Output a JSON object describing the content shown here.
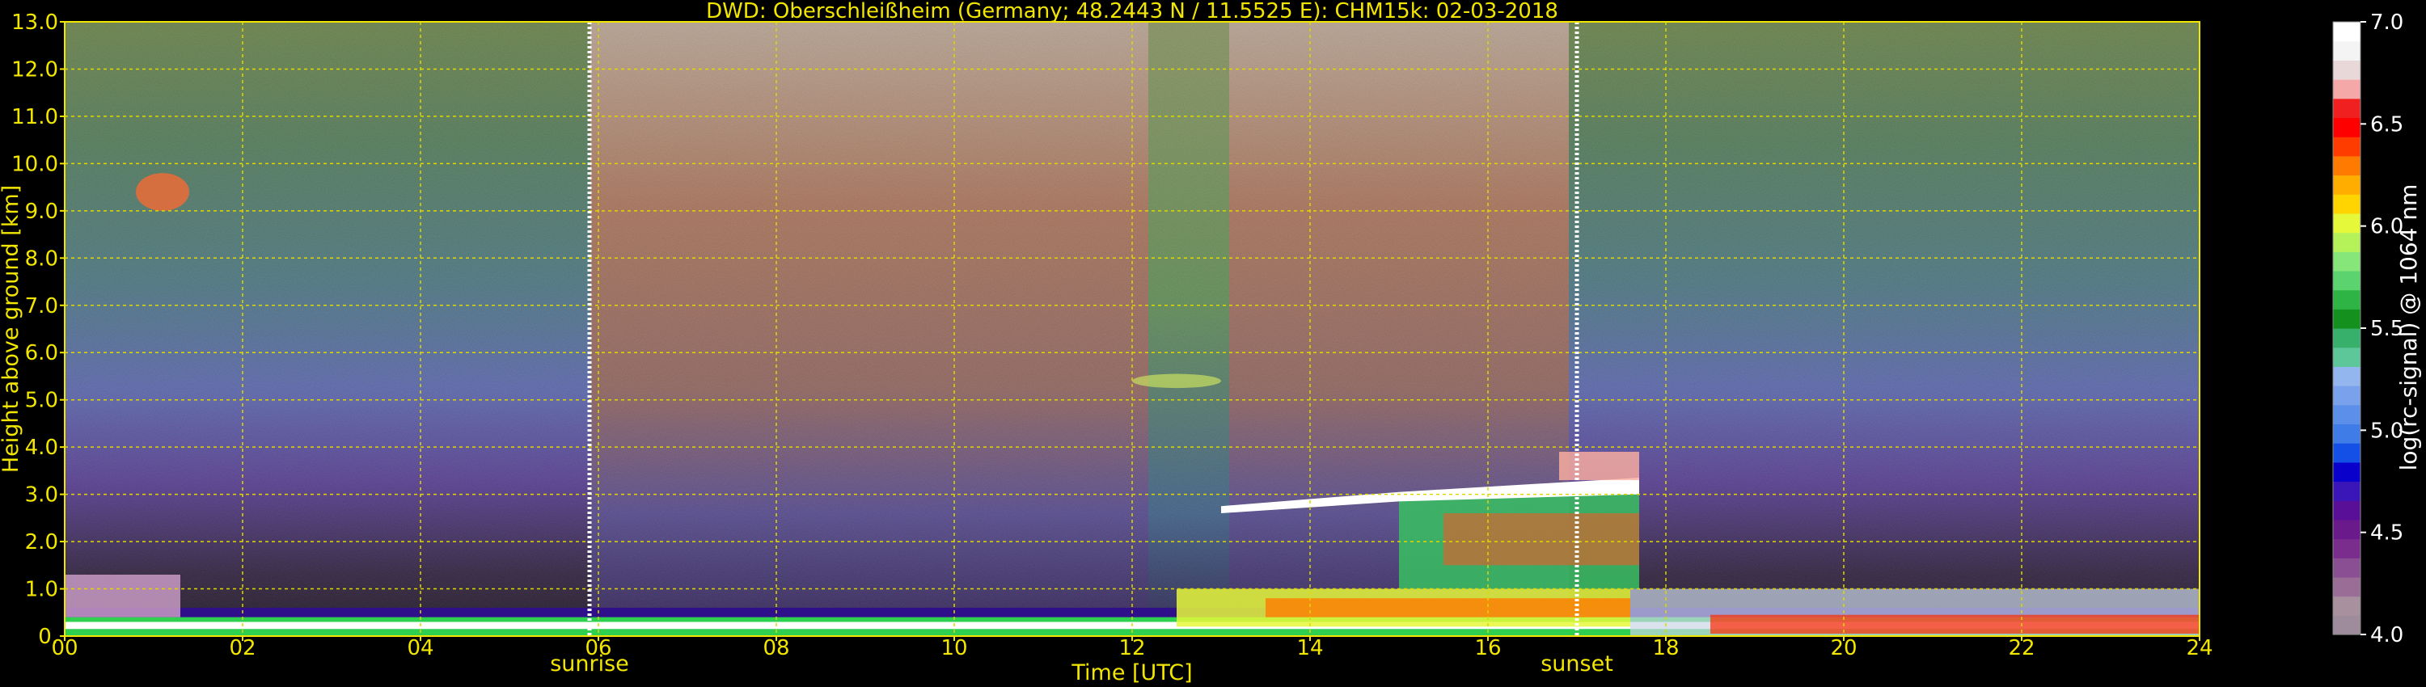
{
  "chart_data": {
    "type": "heatmap",
    "title": "DWD: Oberschleißheim (Germany; 48.2443 N / 11.5525 E):    CHM15k: 02-03-2018",
    "xlabel": "Time [UTC]",
    "ylabel": "Height above ground [km]",
    "xlim": [
      0,
      24
    ],
    "ylim": [
      0,
      13
    ],
    "x_ticks": [
      0,
      2,
      4,
      6,
      8,
      10,
      12,
      14,
      16,
      18,
      20,
      22,
      24
    ],
    "x_tick_labels": [
      "00",
      "02",
      "04",
      "06",
      "08",
      "10",
      "12",
      "14",
      "16",
      "18",
      "20",
      "22",
      "24"
    ],
    "y_ticks": [
      0,
      1,
      2,
      3,
      4,
      5,
      6,
      7,
      8,
      9,
      10,
      11,
      12,
      13
    ],
    "y_tick_labels": [
      "0.",
      "1.0",
      "2.0",
      "3.0",
      "4.0",
      "5.0",
      "6.0",
      "7.0",
      "8.0",
      "9.0",
      "10.0",
      "11.0",
      "12.0",
      "13.0"
    ],
    "grid": true,
    "annotations": [
      {
        "text": "sunrise",
        "x": 5.9
      },
      {
        "text": "sunset",
        "x": 17.0
      }
    ],
    "colorbar": {
      "label": "log(rc-signal) @ 1064 nm",
      "range": [
        4.0,
        7.0
      ],
      "ticks": [
        4.0,
        4.5,
        5.0,
        5.5,
        6.0,
        6.5,
        7.0
      ],
      "tick_labels": [
        "4.0",
        "4.5",
        "5.0",
        "5.5",
        "6.0",
        "6.5",
        "7.0"
      ],
      "colors": [
        "#9e8c9c",
        "#a8909e",
        "#9a6d97",
        "#8a4f92",
        "#7b2d8d",
        "#6a1a8a",
        "#5a0f99",
        "#3a16b8",
        "#0a00cc",
        "#1450e6",
        "#3f7ce8",
        "#5b8fea",
        "#7aa2ec",
        "#94b6ee",
        "#5ec79a",
        "#36b06a",
        "#14901f",
        "#2eb444",
        "#5bd36e",
        "#86e67a",
        "#b5f25a",
        "#e6f83a",
        "#ffd400",
        "#ffae00",
        "#ff7a00",
        "#ff3c00",
        "#ff0000",
        "#f02020",
        "#f4a8a8",
        "#e8d8d8",
        "#f4f4f4",
        "#ffffff"
      ]
    },
    "features": [
      {
        "name": "surface layer",
        "t_start": 0,
        "t_end": 24,
        "h_low": 0.0,
        "h_high": 0.4
      },
      {
        "name": "cloud layer",
        "t_start": 13.0,
        "t_end": 17.7,
        "h_low": 2.8,
        "h_high": 3.9
      },
      {
        "name": "thin layer",
        "t_start": 12.0,
        "t_end": 13.0,
        "h_low": 5.1,
        "h_high": 5.7
      },
      {
        "name": "aerosol patch",
        "t_start": 0.8,
        "t_end": 1.4,
        "h_low": 9.0,
        "h_high": 9.8
      }
    ],
    "colors": {
      "axis_text": "#f2e600",
      "grid": "#e0d800",
      "background": "#000000"
    }
  }
}
